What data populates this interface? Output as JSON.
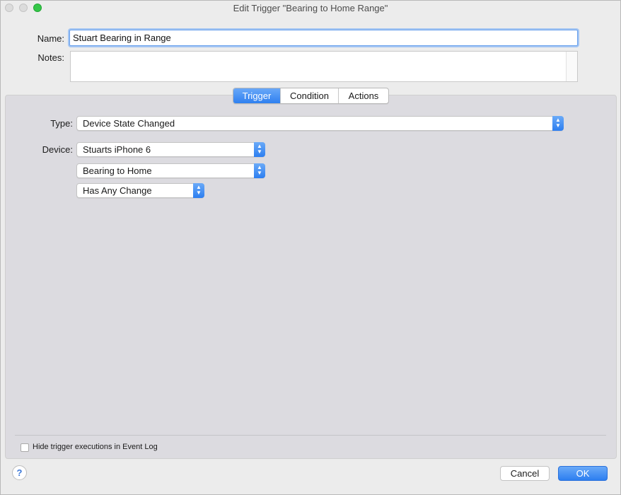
{
  "window": {
    "title": "Edit Trigger \"Bearing to Home Range\""
  },
  "form": {
    "name_label": "Name:",
    "name_value": "Stuart Bearing in Range",
    "notes_label": "Notes:",
    "notes_value": ""
  },
  "tabs": [
    {
      "label": "Trigger",
      "selected": true
    },
    {
      "label": "Condition",
      "selected": false
    },
    {
      "label": "Actions",
      "selected": false
    }
  ],
  "trigger": {
    "type_label": "Type:",
    "type_value": "Device State Changed",
    "device_label": "Device:",
    "device_value": "Stuarts iPhone 6",
    "state_value": "Bearing to Home",
    "change_value": "Has Any Change"
  },
  "footer": {
    "hide_checkbox_label": "Hide trigger executions in Event Log",
    "hide_checked": false,
    "help_symbol": "?",
    "cancel_label": "Cancel",
    "ok_label": "OK"
  },
  "colors": {
    "accent": "#2f80f0",
    "panel_bg": "#dcdbe0",
    "window_bg": "#ececec",
    "zoom_button": "#35c748"
  },
  "icons": {
    "stepper": "up-down-chevron-icon",
    "help": "question-mark-icon"
  }
}
